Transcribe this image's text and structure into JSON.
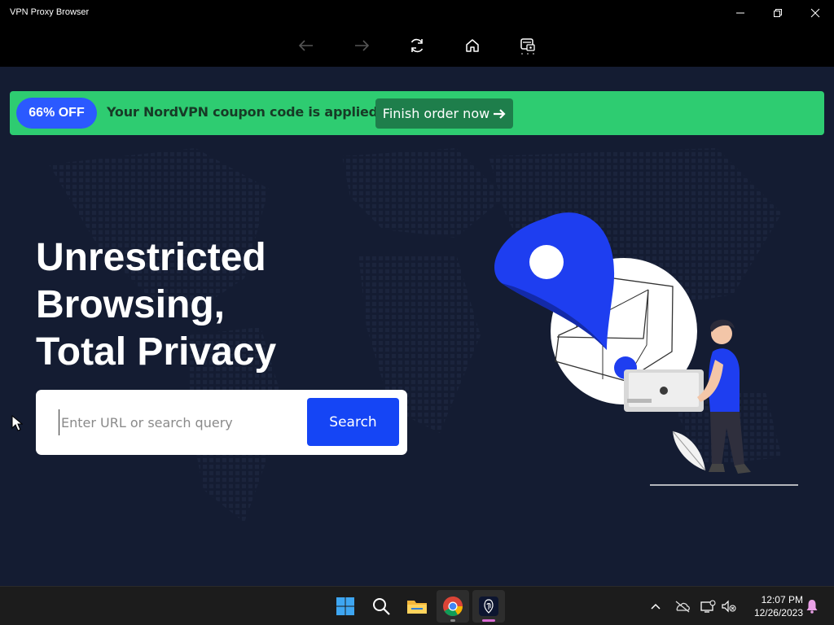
{
  "window": {
    "title": "VPN Proxy Browser",
    "controls": [
      "minimize-icon",
      "restore-icon",
      "close-icon"
    ]
  },
  "toolbar": {
    "buttons": [
      "back-arrow-icon",
      "forward-arrow-icon",
      "refresh-icon",
      "home-icon",
      "vpn-shield-icon"
    ]
  },
  "promo": {
    "badge": "66% OFF",
    "message": "Your NordVPN coupon code is applied",
    "button_label": "Finish order now",
    "button_icon": "arrow-right-icon",
    "colors": {
      "banner": "#2ecc71",
      "badge": "#2b59ff",
      "button": "#1e7e4b"
    }
  },
  "hero": {
    "line1": "Unrestricted",
    "line2": "Browsing,",
    "line3": "Total Privacy"
  },
  "search": {
    "placeholder": "Enter URL or search query",
    "value": "",
    "button_label": "Search",
    "button_color": "#1545f5"
  },
  "taskbar": {
    "apps": [
      "windows-start-icon",
      "search-icon",
      "file-explorer-icon",
      "chrome-icon",
      "vpn-proxy-browser-icon"
    ],
    "tray": [
      "chevron-up-icon",
      "onedrive-offline-icon",
      "network-icon",
      "volume-muted-icon",
      "notification-bell-icon"
    ],
    "time": "12:07 PM",
    "date": "12/26/2023"
  },
  "colors": {
    "page_background": "#141c32",
    "accent_blue": "#1545f5"
  }
}
